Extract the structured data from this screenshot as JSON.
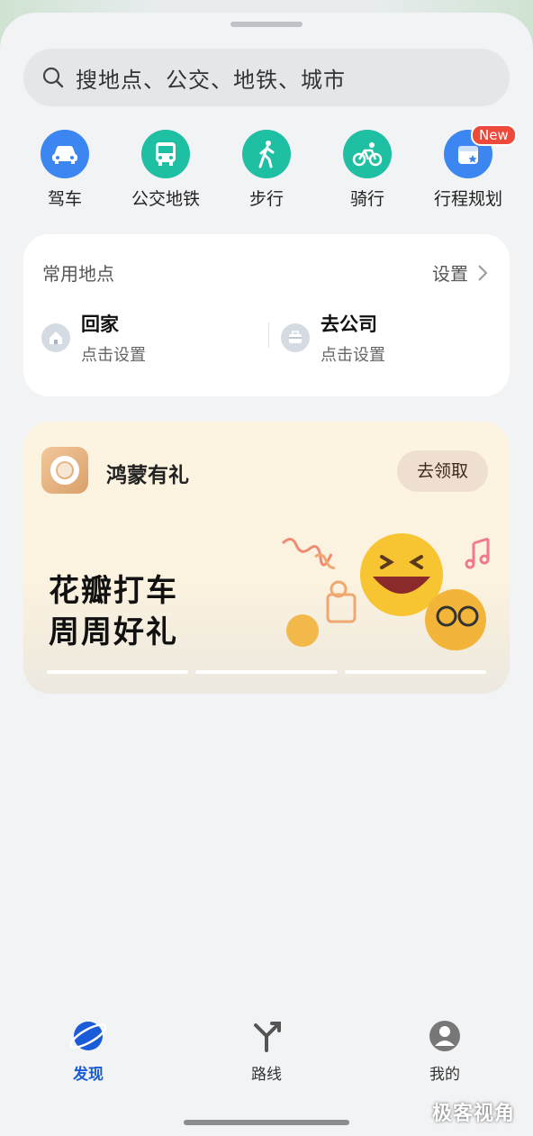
{
  "search": {
    "placeholder": "搜地点、公交、地铁、城市"
  },
  "quick_actions": [
    {
      "label": "驾车",
      "icon": "car-icon",
      "color": "#3b86f0"
    },
    {
      "label": "公交地铁",
      "icon": "bus-icon",
      "color": "#1fbfa4"
    },
    {
      "label": "步行",
      "icon": "walk-icon",
      "color": "#1fbfa4"
    },
    {
      "label": "骑行",
      "icon": "bike-icon",
      "color": "#1fbfa4"
    },
    {
      "label": "行程规划",
      "icon": "calendar-icon",
      "color": "#3b86f0",
      "badge": "New"
    }
  ],
  "places": {
    "title": "常用地点",
    "setting_label": "设置",
    "home": {
      "name": "回家",
      "sub": "点击设置"
    },
    "work": {
      "name": "去公司",
      "sub": "点击设置"
    }
  },
  "promo": {
    "brand": "鸿蒙有礼",
    "claim_label": "去领取",
    "headline_1": "花瓣打车",
    "headline_2": "周周好礼"
  },
  "tabs": [
    {
      "label": "发现",
      "active": true
    },
    {
      "label": "路线",
      "active": false
    },
    {
      "label": "我的",
      "active": false
    }
  ],
  "watermark": "极客视角",
  "colors": {
    "accent": "#1a5bd8",
    "badge": "#ee4a3b"
  }
}
